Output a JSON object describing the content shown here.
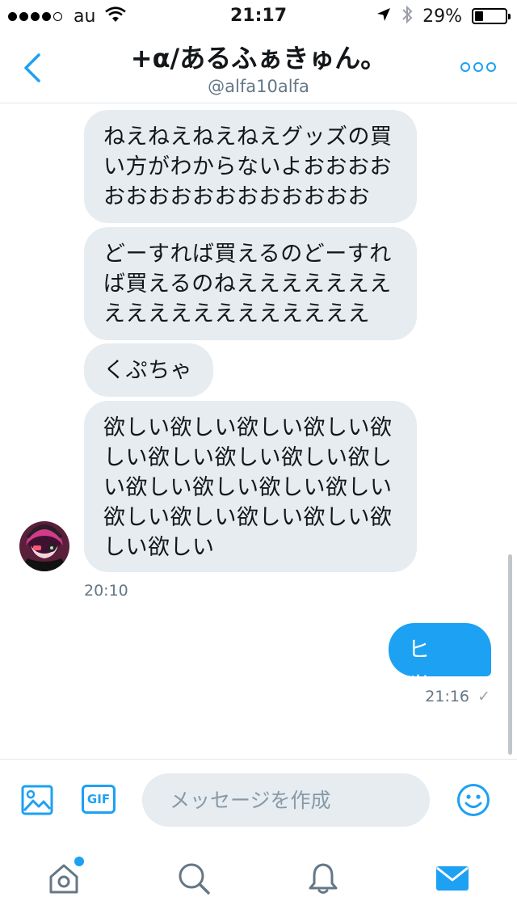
{
  "status_bar": {
    "carrier": "au",
    "time": "21:17",
    "battery_percent": "29%",
    "battery_level": 0.29
  },
  "header": {
    "display_name": "+α/あるふぁきゅん。",
    "handle": "@alfa10alfa",
    "back_icon": "chevron-left-icon",
    "more_icon": "more-dots-icon"
  },
  "conversation": {
    "incoming": [
      "ねえねえねえねえグッズの買\nい方がわからないよおおおお\nおおおおおおおおおおおお",
      "どーすれば買えるのどーすれ\nば買えるのねえええええええ\nええええええええええええ",
      "くぷちゃ",
      "欲しい欲しい欲しい欲しい欲\nしい欲しい欲しい欲しい欲し\nい欲しい欲しい欲しい欲しい\n欲しい欲しい欲しい欲しい欲\nしい欲しい"
    ],
    "incoming_time": "20:10",
    "outgoing": "ヒッ…",
    "outgoing_time": "21:16",
    "read_mark": "✓"
  },
  "composer": {
    "placeholder": "メッセージを作成",
    "gif_label": "GIF",
    "icons": [
      "image-icon",
      "gif-icon",
      "emoji-icon"
    ]
  },
  "tabs": [
    {
      "name": "home",
      "icon": "home-icon",
      "active": false,
      "has_notification": true
    },
    {
      "name": "search",
      "icon": "search-icon",
      "active": false
    },
    {
      "name": "notifications",
      "icon": "bell-icon",
      "active": false
    },
    {
      "name": "messages",
      "icon": "envelope-icon",
      "active": true
    }
  ],
  "colors": {
    "accent": "#1da1f2",
    "bubble_incoming": "#e6ecf0",
    "secondary_text": "#657786",
    "tab_inactive": "#657786"
  }
}
